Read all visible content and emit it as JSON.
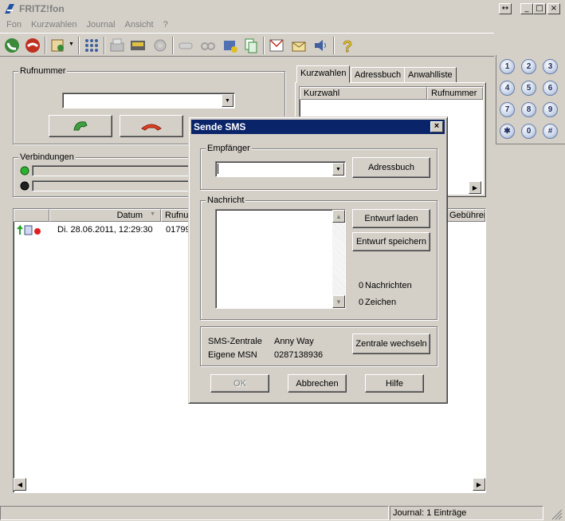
{
  "window": {
    "title": "FRITZ!fon",
    "controls": {
      "restore": "↔",
      "minimize": "_",
      "maximize": "□",
      "close": "×"
    }
  },
  "menu": [
    "Fon",
    "Kurzwahlen",
    "Journal",
    "Ansicht",
    "?"
  ],
  "toolbar": {
    "icons": [
      "call-green-icon",
      "hangup-red-icon",
      "phonebook-dropdown-icon",
      "keypad-icon",
      "fax-icon",
      "display-icon",
      "settings-icon",
      "voicemail-icon",
      "answering-machine-icon",
      "sms-icon",
      "copy-icon",
      "mail-icon",
      "letter-icon",
      "sound-icon",
      "help-icon"
    ]
  },
  "rufnummer": {
    "legend": "Rufnummer",
    "value": ""
  },
  "verbindungen": {
    "legend": "Verbindungen"
  },
  "tabs": [
    "Kurzwahlen",
    "Adressbuch",
    "Anwahlliste"
  ],
  "kurzwahl_table": {
    "columns": [
      "Kurzwahl",
      "Rufnummer"
    ]
  },
  "journal": {
    "columns": [
      "",
      "Datum",
      "Rufnu",
      "Gebühren"
    ],
    "rows": [
      {
        "date": "Di. 28.06.2011, 12:29:30",
        "number": "01799"
      }
    ]
  },
  "keypad": [
    "1",
    "2",
    "3",
    "4",
    "5",
    "6",
    "7",
    "8",
    "9",
    "✱",
    "0",
    "#"
  ],
  "dialog": {
    "title": "Sende SMS",
    "empfaenger": {
      "legend": "Empfänger",
      "value": "",
      "button": "Adressbuch"
    },
    "nachricht": {
      "legend": "Nachricht",
      "buttons": [
        "Entwurf laden",
        "Entwurf speichern"
      ],
      "nachrichten_count": "0",
      "nachrichten_label": "Nachrichten",
      "zeichen_count": "0",
      "zeichen_label": "Zeichen"
    },
    "zentrale": {
      "label1": "SMS-Zentrale",
      "value1": "Anny Way",
      "label2": "Eigene MSN",
      "value2": "0287138936",
      "button": "Zentrale wechseln"
    },
    "buttons": {
      "ok": "OK",
      "cancel": "Abbrechen",
      "help": "Hilfe"
    }
  },
  "statusbar": {
    "text": "Journal: 1 Einträge"
  }
}
